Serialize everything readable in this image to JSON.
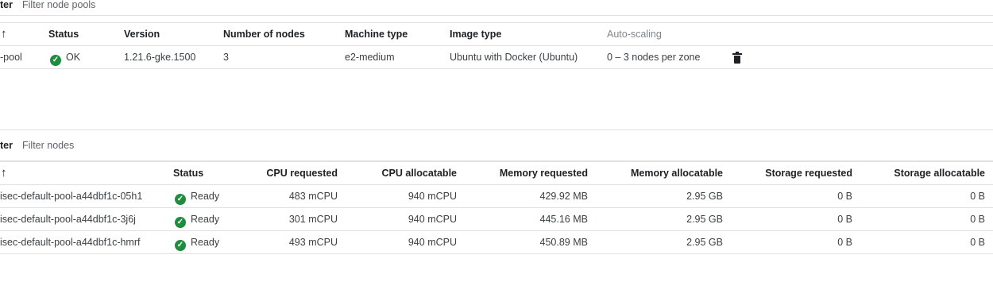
{
  "node_pools": {
    "filter_label": "ter",
    "filter_placeholder": "Filter node pools",
    "headers": {
      "sort": "↑",
      "status": "Status",
      "version": "Version",
      "num_nodes": "Number of nodes",
      "machine_type": "Machine type",
      "image_type": "Image type",
      "autoscaling": "Auto-scaling"
    },
    "rows": [
      {
        "name": "-pool",
        "status": "OK",
        "version": "1.21.6-gke.1500",
        "num_nodes": "3",
        "machine_type": "e2-medium",
        "image_type": "Ubuntu with Docker (Ubuntu)",
        "autoscaling": "0 – 3 nodes per zone"
      }
    ]
  },
  "nodes": {
    "filter_label": "ter",
    "filter_placeholder": "Filter nodes",
    "headers": {
      "sort": "↑",
      "status": "Status",
      "cpu_requested": "CPU requested",
      "cpu_allocatable": "CPU allocatable",
      "memory_requested": "Memory requested",
      "memory_allocatable": "Memory allocatable",
      "storage_requested": "Storage requested",
      "storage_allocatable": "Storage allocatable"
    },
    "rows": [
      {
        "name": "isec-default-pool-a44dbf1c-05h1",
        "status": "Ready",
        "cpu_requested": "483 mCPU",
        "cpu_allocatable": "940 mCPU",
        "memory_requested": "429.92 MB",
        "memory_allocatable": "2.95 GB",
        "storage_requested": "0 B",
        "storage_allocatable": "0 B"
      },
      {
        "name": "isec-default-pool-a44dbf1c-3j6j",
        "status": "Ready",
        "cpu_requested": "301 mCPU",
        "cpu_allocatable": "940 mCPU",
        "memory_requested": "445.16 MB",
        "memory_allocatable": "2.95 GB",
        "storage_requested": "0 B",
        "storage_allocatable": "0 B"
      },
      {
        "name": "isec-default-pool-a44dbf1c-hmrf",
        "status": "Ready",
        "cpu_requested": "493 mCPU",
        "cpu_allocatable": "940 mCPU",
        "memory_requested": "450.89 MB",
        "memory_allocatable": "2.95 GB",
        "storage_requested": "0 B",
        "storage_allocatable": "0 B"
      }
    ]
  },
  "icons": {
    "status_ok": "check-circle-icon",
    "delete": "trash-icon",
    "sort": "arrow-up-icon"
  },
  "colors": {
    "status_ok": "#1e8e3e",
    "muted_header": "#80868b"
  }
}
